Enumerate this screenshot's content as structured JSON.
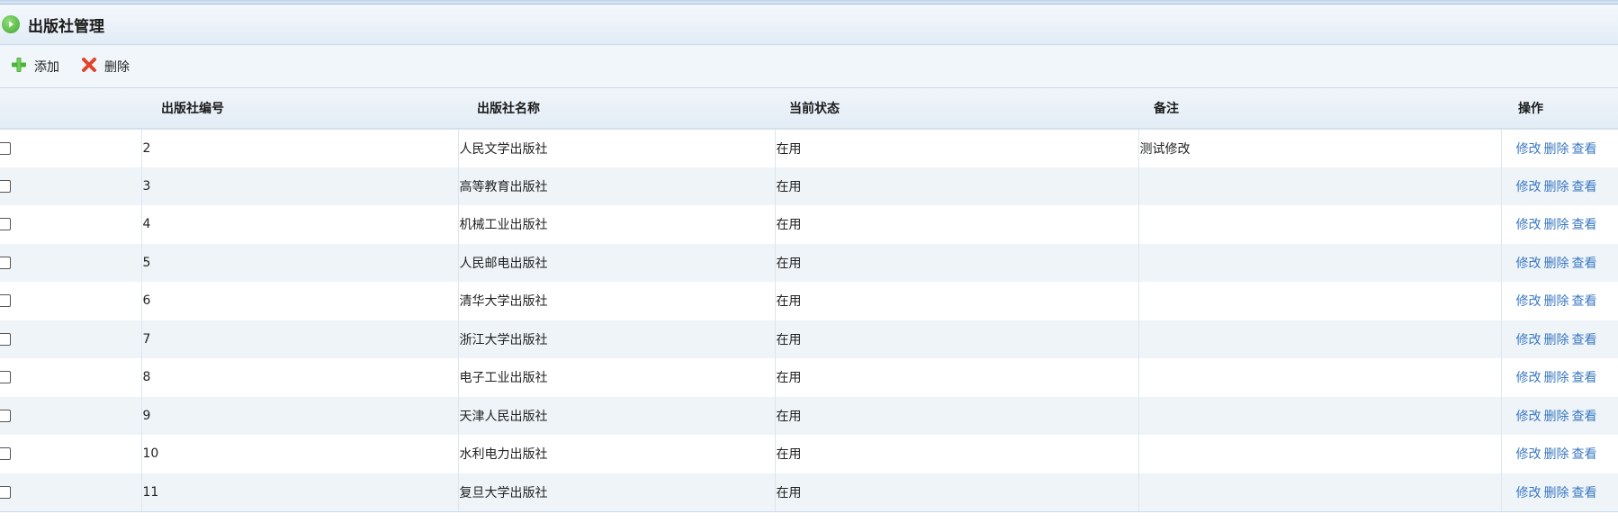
{
  "header": {
    "title": "出版社管理"
  },
  "toolbar": {
    "add_label": "添加",
    "delete_label": "删除"
  },
  "table": {
    "columns": [
      "出版社编号",
      "出版社名称",
      "当前状态",
      "备注",
      "操作"
    ],
    "rows": [
      {
        "id": "2",
        "name": "人民文学出版社",
        "status": "在用",
        "note": "测试修改"
      },
      {
        "id": "3",
        "name": "高等教育出版社",
        "status": "在用",
        "note": ""
      },
      {
        "id": "4",
        "name": "机械工业出版社",
        "status": "在用",
        "note": ""
      },
      {
        "id": "5",
        "name": "人民邮电出版社",
        "status": "在用",
        "note": ""
      },
      {
        "id": "6",
        "name": "清华大学出版社",
        "status": "在用",
        "note": ""
      },
      {
        "id": "7",
        "name": "浙江大学出版社",
        "status": "在用",
        "note": ""
      },
      {
        "id": "8",
        "name": "电子工业出版社",
        "status": "在用",
        "note": ""
      },
      {
        "id": "9",
        "name": "天津人民出版社",
        "status": "在用",
        "note": ""
      },
      {
        "id": "10",
        "name": "水利电力出版社",
        "status": "在用",
        "note": ""
      },
      {
        "id": "11",
        "name": "复旦大学出版社",
        "status": "在用",
        "note": ""
      }
    ],
    "actions": {
      "edit": "修改",
      "delete": "删除",
      "view": "查看"
    }
  },
  "colors": {
    "link": "#3a78c2",
    "row_alt": "#eef4f8",
    "header_bg": "#e3edf6"
  }
}
